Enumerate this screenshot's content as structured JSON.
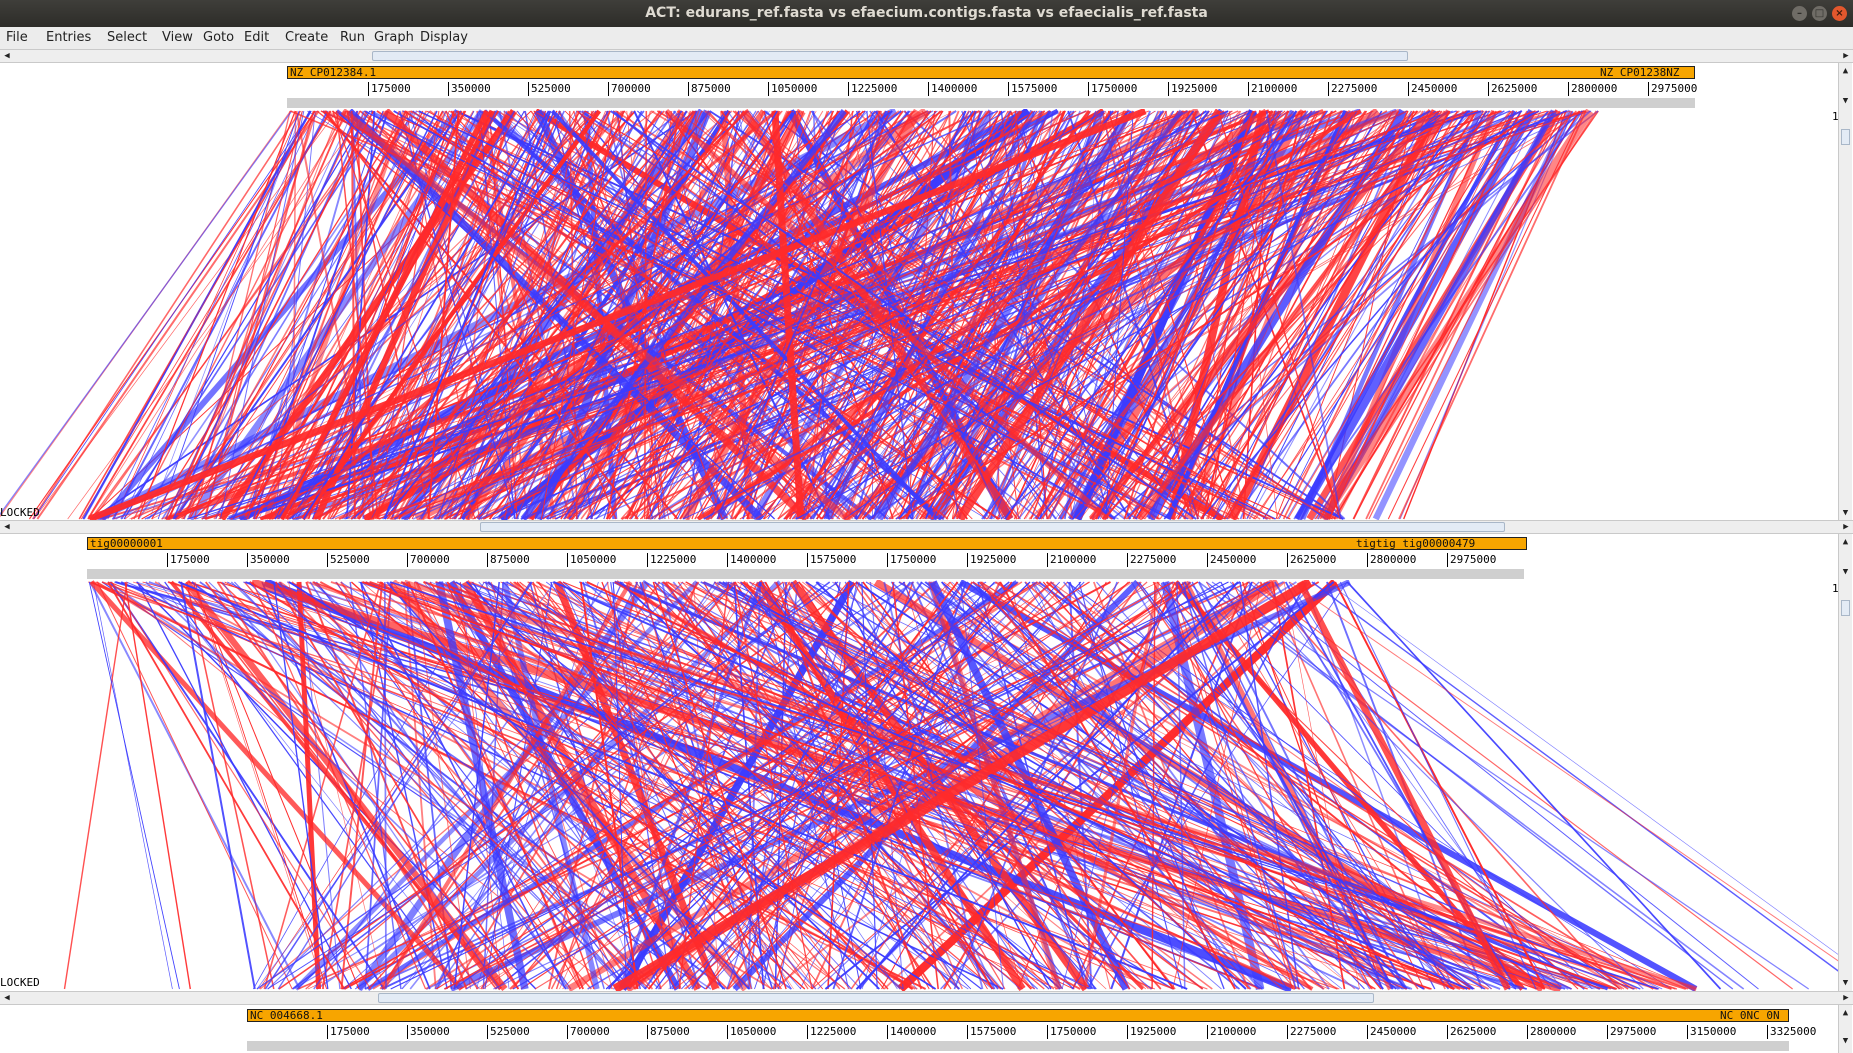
{
  "window": {
    "title": "ACT: edurans_ref.fasta vs efaecium.contigs.fasta vs efaecialis_ref.fasta"
  },
  "menu": [
    "File",
    "Entries",
    "Select",
    "View",
    "Goto",
    "Edit",
    "Create",
    "Run",
    "Graph",
    "Display"
  ],
  "sequences": {
    "top": {
      "primary_label": "NZ_CP012384.1",
      "end_labels": "NZ_CP01238NZ",
      "ticks": [
        "175000",
        "350000",
        "525000",
        "700000",
        "875000",
        "1050000",
        "1225000",
        "1400000",
        "1575000",
        "1750000",
        "1925000",
        "2100000",
        "2275000",
        "2450000",
        "2625000",
        "2800000",
        "2975000"
      ]
    },
    "middle": {
      "primary_label": "tig00000001",
      "end_labels": "tigtig  tig00000479",
      "ticks": [
        "175000",
        "350000",
        "525000",
        "700000",
        "875000",
        "1050000",
        "1225000",
        "1400000",
        "1575000",
        "1750000",
        "1925000",
        "2100000",
        "2275000",
        "2450000",
        "2625000",
        "2800000",
        "2975000"
      ]
    },
    "bottom": {
      "primary_label": "NC_004668.1",
      "end_labels": "NC_0NC_0N",
      "ticks": [
        "175000",
        "350000",
        "525000",
        "700000",
        "875000",
        "1050000",
        "1225000",
        "1400000",
        "1575000",
        "1750000",
        "1925000",
        "2100000",
        "2275000",
        "2450000",
        "2625000",
        "2800000",
        "2975000",
        "3150000",
        "3325000"
      ]
    }
  },
  "comparisons": {
    "upper_status": "LOCKED",
    "lower_status": "LOCKED",
    "upper_side_value": "1",
    "lower_side_value": "1"
  },
  "colors": {
    "forward_match": "#ff2a2a",
    "reverse_match": "#3b3bff",
    "sequence_bar": "#f7a500"
  }
}
